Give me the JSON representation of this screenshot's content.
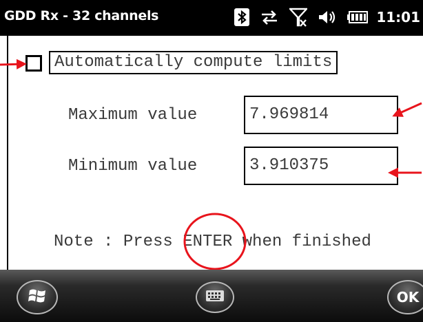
{
  "statusbar": {
    "title": "GDD Rx - 32 channels",
    "icons": [
      "bluetooth-icon",
      "data-sync-icon",
      "no-signal-icon",
      "volume-icon",
      "battery-icon"
    ],
    "time": "11:01"
  },
  "form": {
    "auto_compute_label": "Automatically compute limits",
    "auto_compute_checked": false,
    "max_label": "Maximum value",
    "max_value": "7.969814",
    "min_label": "Minimum value",
    "min_value": "3.910375",
    "note_prefix": "Note : Press",
    "note_key": "ENTER",
    "note_suffix": "when finished"
  },
  "bottombar": {
    "start_icon": "windows-start-icon",
    "keyboard_icon": "keyboard-icon",
    "ok_label": "OK"
  },
  "colors": {
    "annotation_red": "#e8141c",
    "statusbar_bg": "#000000"
  }
}
